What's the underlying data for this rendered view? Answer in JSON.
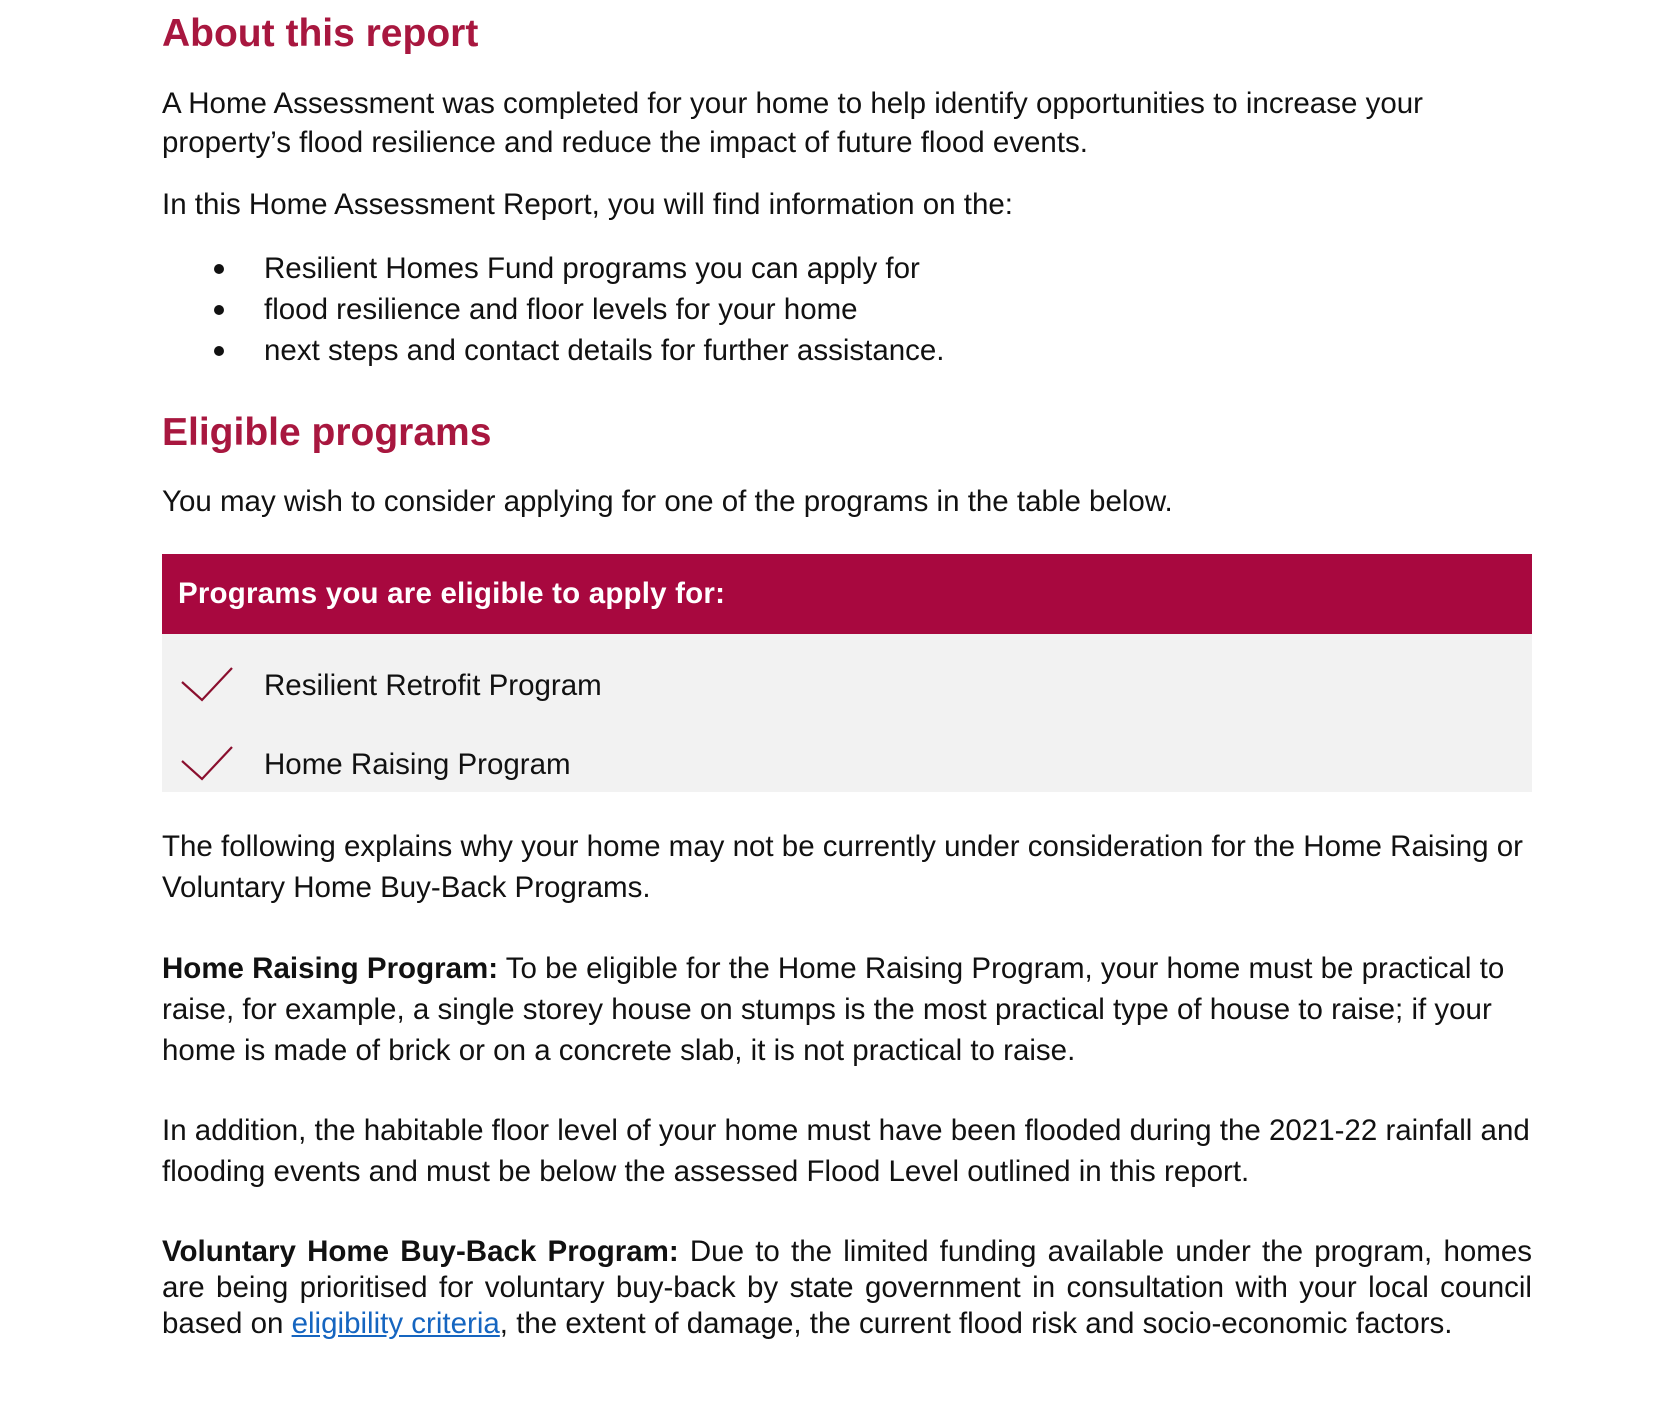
{
  "about": {
    "heading": "About this report",
    "intro": "A Home Assessment was completed for your home to help identify opportunities to increase your property’s flood resilience and reduce the impact of future flood events.",
    "lead_in": "In this Home Assessment Report, you will find information on the:",
    "bullets": [
      "Resilient Homes Fund programs you can apply for",
      "flood resilience and floor levels for your home",
      "next steps and contact details for further assistance."
    ]
  },
  "eligible": {
    "heading": "Eligible programs",
    "intro": "You may wish to consider applying for one of the programs in the table below.",
    "table": {
      "header": "Programs you are eligible to apply for:",
      "rows": [
        {
          "icon": "checkmark-icon",
          "label": "Resilient Retrofit Program"
        },
        {
          "icon": "checkmark-icon",
          "label": "Home Raising Program"
        }
      ]
    },
    "explanation": "The following explains why your home may not be currently under consideration for the Home Raising or Voluntary Home Buy-Back Programs.",
    "home_raising": {
      "label": "Home Raising Program:",
      "text": " To be eligible for the Home Raising Program, your home must be practical to raise, for example, a single storey house on stumps is the most practical type of house to raise; if your home is made of brick or on a concrete slab, it is not practical to raise.",
      "addition": "In addition, the habitable floor level of your home must have been flooded during the 2021-22 rainfall and flooding events and must be below the assessed Flood Level outlined in this report."
    },
    "buyback": {
      "label": "Voluntary Home Buy-Back Program:",
      "text_before_link": " Due to the limited funding available under the program, homes are being prioritised for voluntary buy-back by state government in consultation with your local council based on ",
      "link_text": "eligibility criteria",
      "text_after_link": ", the extent of damage, the current flood risk and socio-economic factors."
    }
  },
  "colors": {
    "heading": "#a8173f",
    "table_header_bg": "#a8083f",
    "table_body_bg": "#f2f2f2",
    "link": "#1565c0"
  }
}
